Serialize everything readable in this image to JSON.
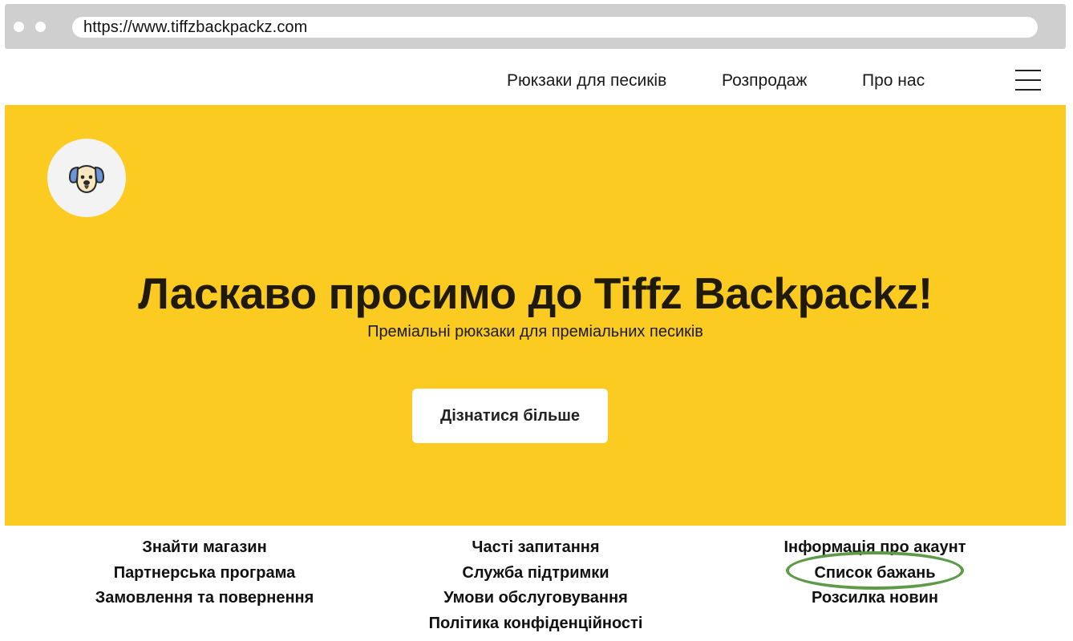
{
  "browser": {
    "url": "https://www.tiffzbackpackz.com"
  },
  "nav": {
    "links": [
      "Рюкзаки для песиків",
      "Розпродаж",
      "Про нас"
    ],
    "menu_icon": "hamburger-menu-icon"
  },
  "hero": {
    "logo_icon": "dog-face-icon",
    "title": "Ласкаво просимо до Tiffz Backpackz!",
    "subtitle": "Преміальні рюкзаки для преміальних песиків",
    "cta_label": "Дізнатися більше",
    "background_color": "#fccb22"
  },
  "footer": {
    "columns": [
      [
        "Знайти магазин",
        "Партнерська програма",
        "Замовлення та повернення"
      ],
      [
        "Часті запитання",
        "Служба підтримки",
        "Умови обслуговування",
        "Політика конфіденційності"
      ],
      [
        "Інформація про акаунт",
        "Список бажань",
        "Розсилка новин"
      ]
    ],
    "highlight_color": "#5f9a48"
  }
}
